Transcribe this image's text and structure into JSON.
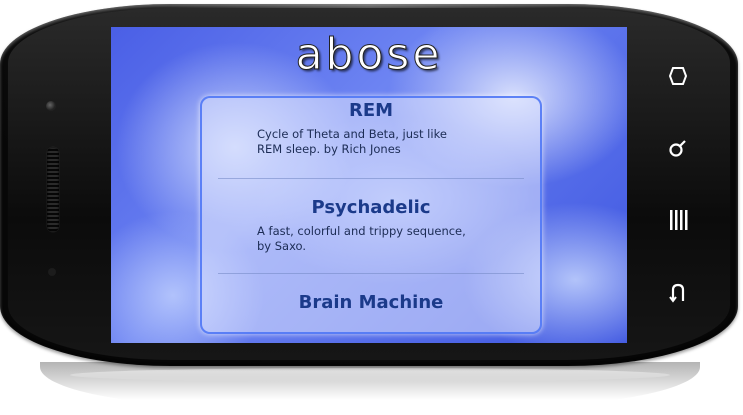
{
  "app": {
    "logo_text": "abose"
  },
  "list": {
    "items": [
      {
        "title": "REM",
        "description": "Cycle of Theta and Beta, just like REM sleep. by Rich Jones"
      },
      {
        "title": "Psychadelic",
        "description": "A fast, colorful and trippy sequence, by Saxo."
      },
      {
        "title": "Brain Machine",
        "description": ""
      }
    ]
  },
  "device": {
    "soft_keys": [
      "rotate-icon",
      "search-icon",
      "menu-icon",
      "back-icon"
    ]
  },
  "colors": {
    "title_text": "#1b3a8a",
    "panel_border": "#5078f5",
    "screen_background": "#4a5fe6"
  }
}
